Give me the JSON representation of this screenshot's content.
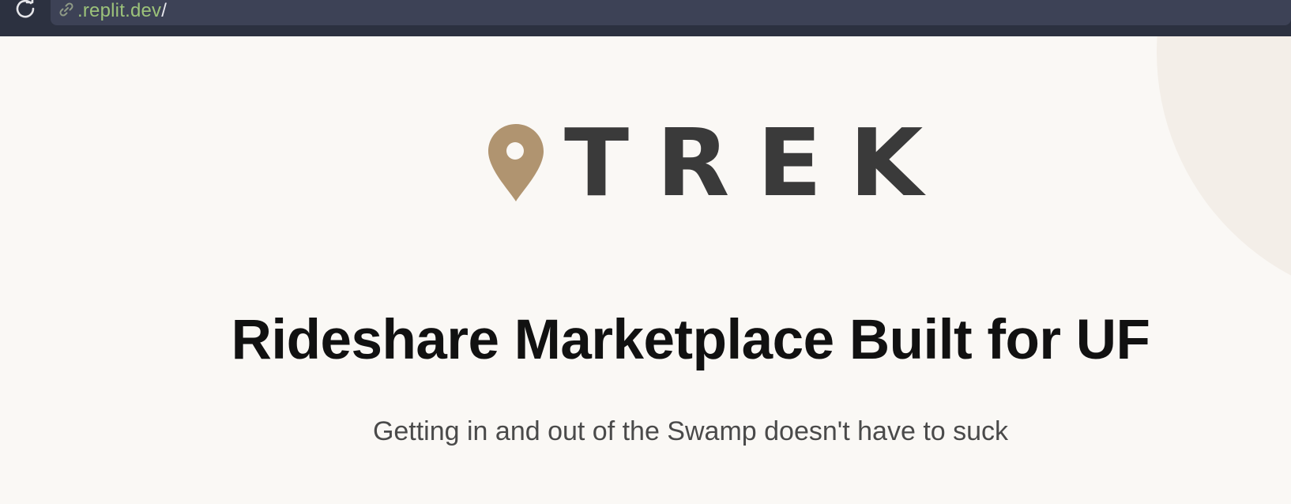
{
  "browser": {
    "url_domain": ".replit.dev",
    "url_path": "/",
    "reload_icon": "reload-icon",
    "link_icon": "link-icon"
  },
  "hero": {
    "logo_text": "TREK",
    "logo_icon": "map-pin-icon",
    "headline": "Rideshare Marketplace Built for UF",
    "subheadline": "Getting in and out of the Swamp doesn't have to suck"
  },
  "colors": {
    "browser_bar": "#2c3140",
    "url_field": "#3d4256",
    "url_text": "#9cc27a",
    "page_bg": "#faf8f5",
    "pin": "#b09470",
    "logo_text": "#3a3a3a",
    "headline": "#111111",
    "subheadline": "#4a4a4a"
  }
}
